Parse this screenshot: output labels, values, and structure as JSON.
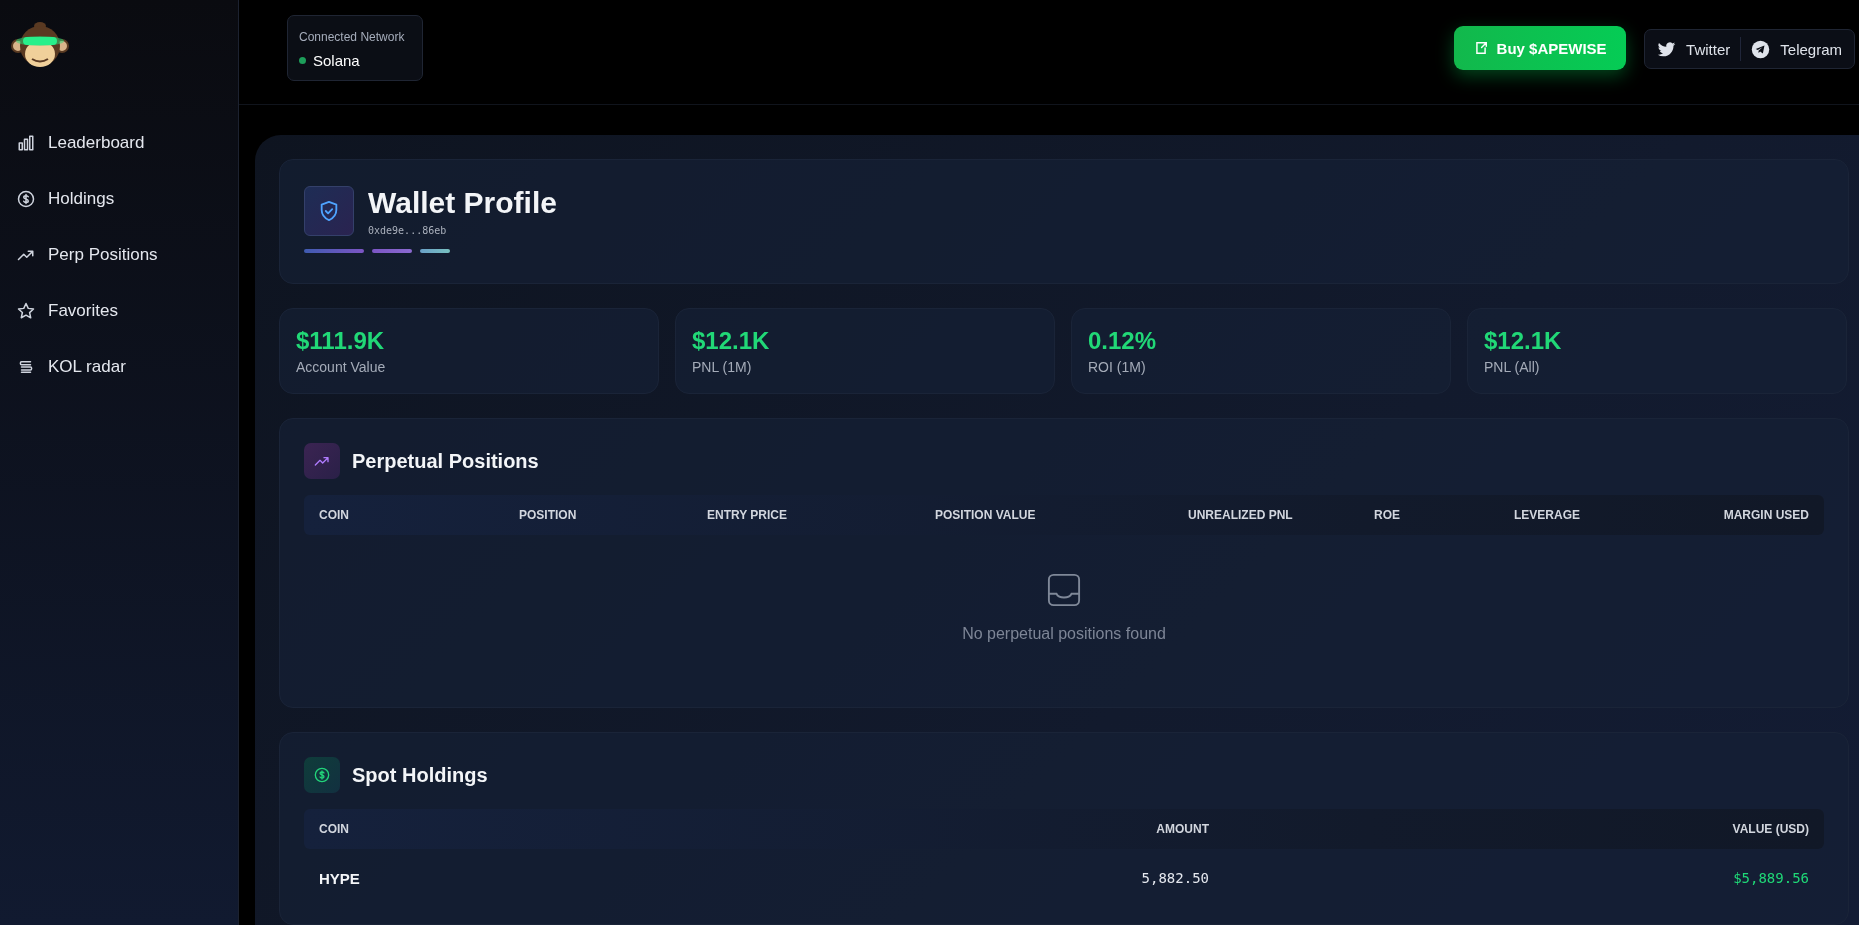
{
  "sidebar": {
    "items": [
      {
        "label": "Leaderboard"
      },
      {
        "label": "Holdings"
      },
      {
        "label": "Perp Positions"
      },
      {
        "label": "Favorites"
      },
      {
        "label": "KOL radar"
      }
    ]
  },
  "header": {
    "network": {
      "label": "Connected Network",
      "name": "Solana"
    },
    "buy_button": "Buy $APEWISE",
    "social_links": [
      "Twitter",
      "Telegram"
    ]
  },
  "wallet": {
    "title": "Wallet Profile",
    "address": "0xde9e...86eb"
  },
  "stats": [
    {
      "value": "$111.9K",
      "label": "Account Value"
    },
    {
      "value": "$12.1K",
      "label": "PNL (1M)"
    },
    {
      "value": "0.12%",
      "label": "ROI (1M)"
    },
    {
      "value": "$12.1K",
      "label": "PNL (All)"
    }
  ],
  "perpetual_positions": {
    "title": "Perpetual Positions",
    "columns": [
      "COIN",
      "POSITION",
      "ENTRY PRICE",
      "POSITION VALUE",
      "UNREALIZED PNL",
      "ROE",
      "LEVERAGE",
      "MARGIN USED"
    ],
    "empty_message": "No perpetual positions found"
  },
  "spot_holdings": {
    "title": "Spot Holdings",
    "columns": [
      "COIN",
      "AMOUNT",
      "VALUE (USD)"
    ],
    "rows": [
      {
        "coin": "HYPE",
        "amount": "5,882.50",
        "value": "$5,889.56"
      }
    ]
  }
}
